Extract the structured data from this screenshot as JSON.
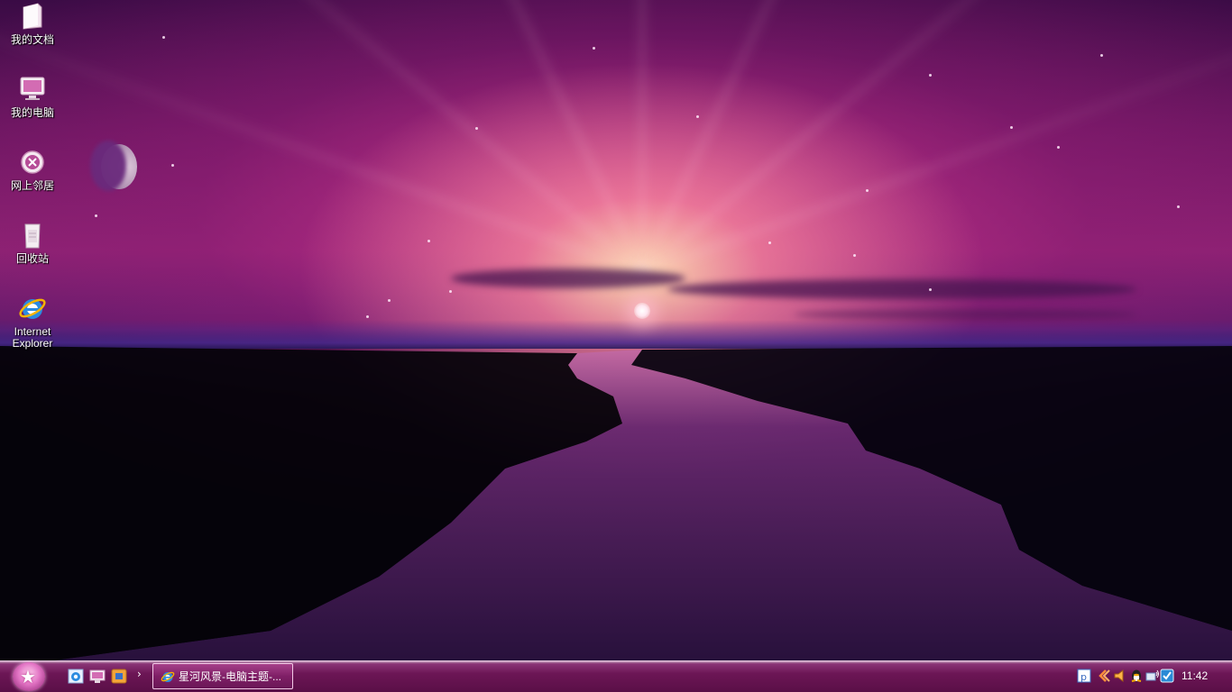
{
  "desktop": {
    "icons": [
      {
        "label": "我的文档",
        "icon": "folder-icon"
      },
      {
        "label": "我的电脑",
        "icon": "computer-icon"
      },
      {
        "label": "网上邻居",
        "icon": "network-icon"
      },
      {
        "label": "回收站",
        "icon": "recycle-bin-icon"
      },
      {
        "label": "Internet\nExplorer",
        "icon": "internet-explorer-icon"
      }
    ]
  },
  "taskbar": {
    "start_icon": "star-icon",
    "quick_launch": [
      {
        "icon": "internet-explorer-icon"
      },
      {
        "icon": "show-desktop-icon"
      },
      {
        "icon": "media-player-icon"
      }
    ],
    "quick_launch_overflow": "›",
    "tasks": [
      {
        "label": "星河风景-电脑主题-...",
        "icon": "internet-explorer-icon"
      }
    ],
    "tray_icons": [
      "pinyin-input-icon",
      "arrows-icon",
      "speaker-icon",
      "qq-penguin-icon",
      "network-connection-icon",
      "security-shield-icon"
    ],
    "clock": "11:42"
  },
  "colors": {
    "taskbar": "#6c1655",
    "accent": "#e274c4",
    "sky_glow": "#ffe2b0"
  }
}
